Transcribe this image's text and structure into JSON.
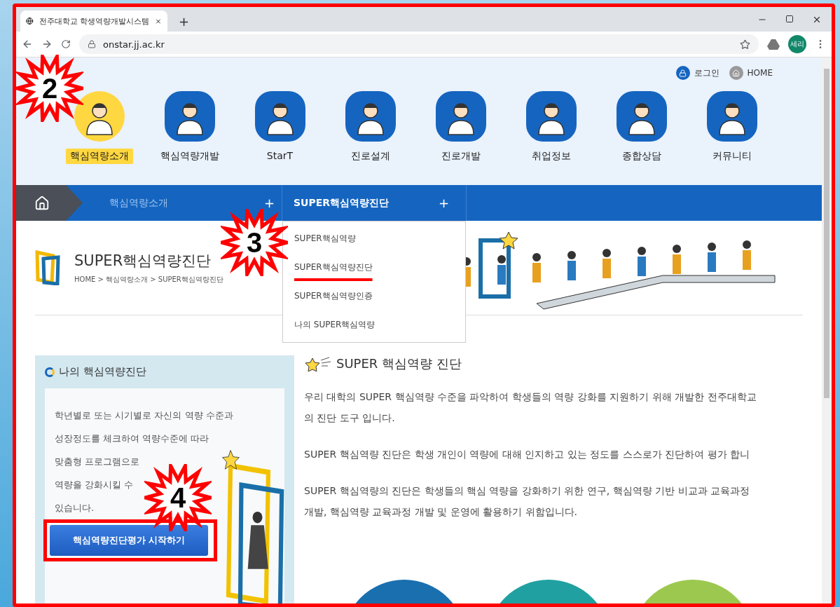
{
  "browser": {
    "tab_title": "전주대학교 학생역량개발시스템",
    "new_tab": "+",
    "url": "onstar.jj.ac.kr",
    "profile": "세리"
  },
  "top_links": [
    "로그인",
    "HOME"
  ],
  "nav": [
    {
      "label": "핵심역량소개",
      "selected": true
    },
    {
      "label": "핵심역량개발",
      "selected": false
    },
    {
      "label": "StarT",
      "selected": false
    },
    {
      "label": "진로설계",
      "selected": false
    },
    {
      "label": "진로개발",
      "selected": false
    },
    {
      "label": "취업정보",
      "selected": false
    },
    {
      "label": "종합상담",
      "selected": false
    },
    {
      "label": "커뮤니티",
      "selected": false
    }
  ],
  "menu_bar": {
    "section": "핵심역량소개",
    "section_toggle": "+",
    "current": "SUPER핵심역량진단",
    "current_toggle": "+",
    "dropdown": [
      {
        "label": "SUPER핵심역량",
        "underlined": false
      },
      {
        "label": "SUPER핵심역량진단",
        "underlined": true
      },
      {
        "label": "SUPER핵심역량인증",
        "underlined": false
      },
      {
        "label": "나의 SUPER핵심역량",
        "underlined": false
      }
    ]
  },
  "page": {
    "title": "SUPER핵심역량진단",
    "breadcrumb": "HOME > 핵심역량소개 > SUPER핵심역량진단"
  },
  "side_panel": {
    "title": "나의 핵심역량진단",
    "lines": [
      "학년별로 또는 시기별로 자신의 역량 수준과",
      "성장정도를 체크하여 역량수준에 따라",
      "맞춤형 프로그램으로",
      "역량을 강화시킬 수",
      "있습니다."
    ],
    "button": "핵심역량진단평가 시작하기"
  },
  "content": {
    "heading": "SUPER 핵심역량 진단",
    "paragraphs": [
      "우리 대학의 SUPER 핵심역량 수준을 파악하여 학생들의 역량 강화를 지원하기 위해 개발한 전주대학교의 진단 도구 입니다.",
      "SUPER 핵심역량 진단은 학생 개인이 역량에 대해 인지하고 있는 정도를 스스로가 진단하여 평가 합니",
      "SUPER 핵심역량의 진단은 학생들의 핵심 역량을 강화하기 위한 연구, 핵심역량 기반 비교과 교육과정 개발, 핵심역량 교육과정 개발 및 운영에 활용하기 위함입니다."
    ]
  },
  "callouts": [
    "2",
    "3",
    "4"
  ]
}
